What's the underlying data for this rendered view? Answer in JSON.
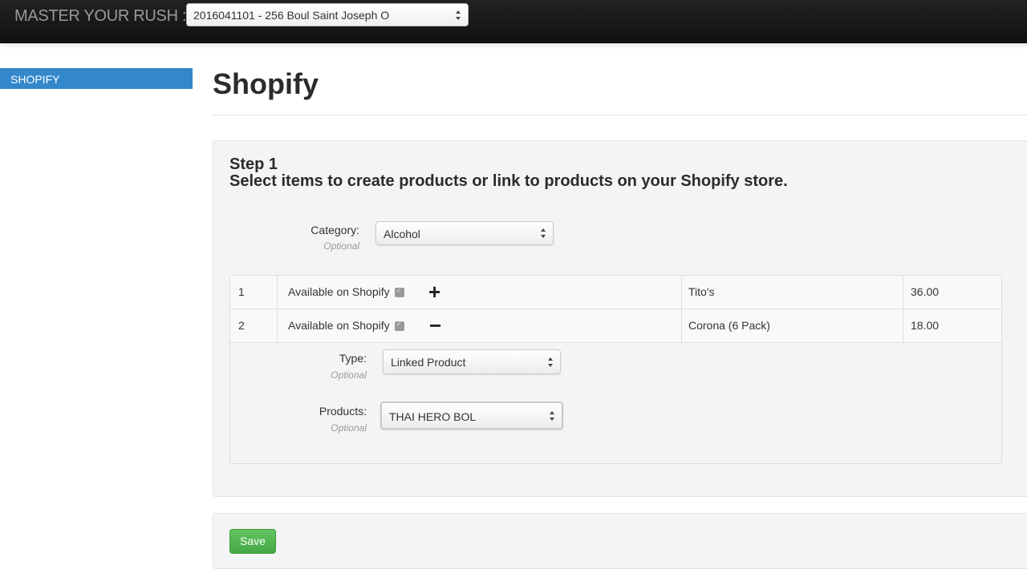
{
  "topbar": {
    "brand": "MASTER YOUR RUSH ::",
    "location_select": "2016041101 - 256 Boul Saint Joseph O"
  },
  "sidebar": {
    "items": [
      {
        "label": "SHOPIFY",
        "active": true
      }
    ]
  },
  "page": {
    "title": "Shopify"
  },
  "step": {
    "title": "Step 1",
    "subtitle": "Select items to create products or link to products on your Shopify store."
  },
  "category": {
    "label": "Category:",
    "optional": "Optional",
    "value": "Alcohol"
  },
  "items": [
    {
      "num": "1",
      "available_label": "Available on Shopify",
      "checked": true,
      "toggle": "+",
      "toggle_icon": "plus-icon",
      "name": "Tito's",
      "price": "36.00"
    },
    {
      "num": "2",
      "available_label": "Available on Shopify",
      "checked": true,
      "toggle": "−",
      "toggle_icon": "minus-icon",
      "name": "Corona (6 Pack)",
      "price": "18.00"
    }
  ],
  "expanded": {
    "type_label": "Type:",
    "type_optional": "Optional",
    "type_value": "Linked Product",
    "products_label": "Products:",
    "products_optional": "Optional",
    "products_value": "THAI HERO BOL"
  },
  "actions": {
    "save_label": "Save"
  },
  "colors": {
    "accent": "#3388cc",
    "save": "#5cb85c",
    "topbar": "#1a1a1a"
  }
}
